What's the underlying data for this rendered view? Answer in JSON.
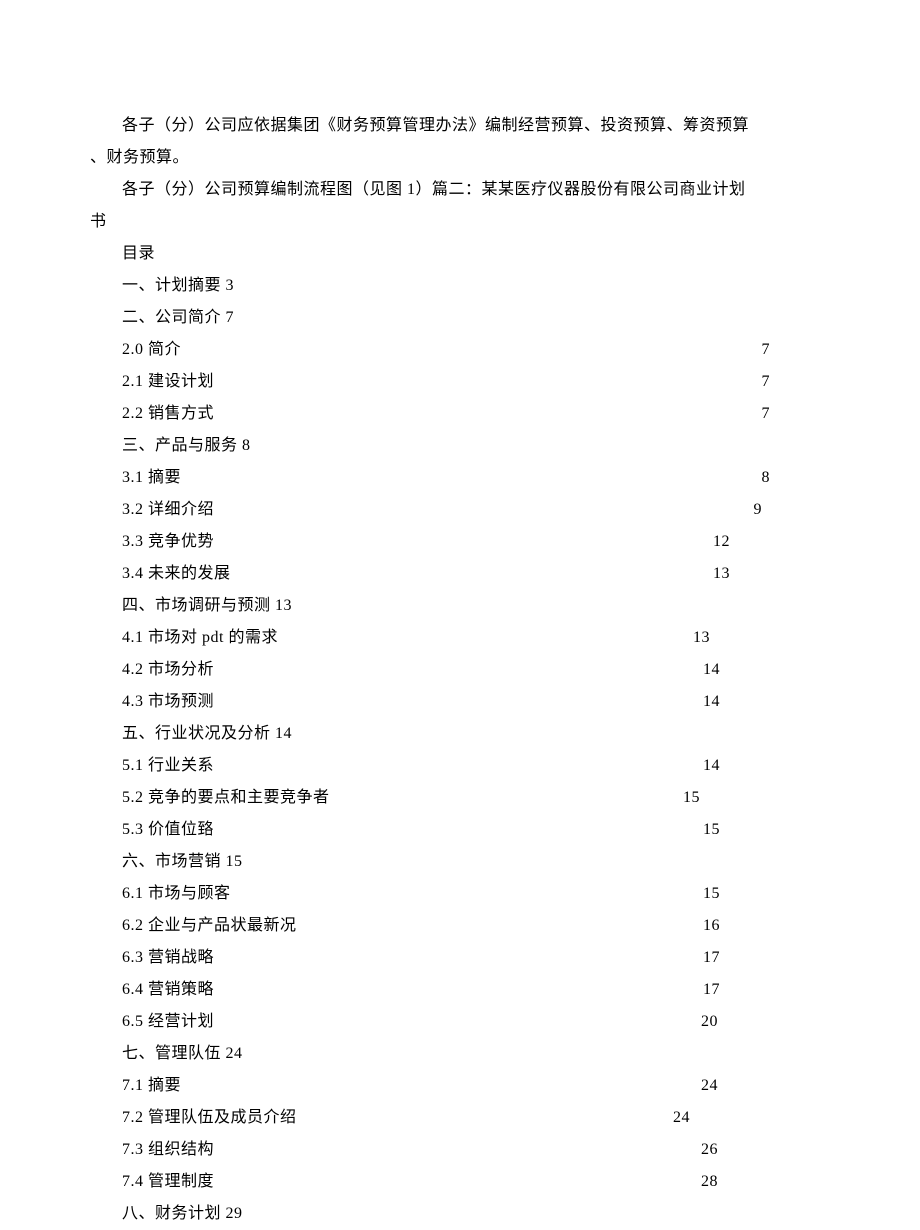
{
  "paragraphs": {
    "p1": "各子（分）公司应依据集团《财务预算管理办法》编制经营预算、投资预算、筹资预算",
    "p1cont": "、财务预算。",
    "p2": "各子（分）公司预算编制流程图（见图 1）篇二：某某医疗仪器股份有限公司商业计划",
    "p2cont": "书"
  },
  "toc": {
    "title": "目录",
    "sections": [
      {
        "label": "一、计划摘要  3",
        "page": ""
      },
      {
        "label": "二、公司简介  7",
        "page": ""
      }
    ],
    "rows": [
      {
        "label": "2.0 简介",
        "page": "7",
        "pos": "pos-7"
      },
      {
        "label": "2.1 建设计划",
        "page": "7",
        "pos": "pos-7"
      },
      {
        "label": "2.2 销售方式",
        "page": "7",
        "pos": "pos-7"
      }
    ],
    "section3": "三、产品与服务  8",
    "rows3": [
      {
        "label": "3.1 摘要",
        "page": "8",
        "pos": "pos-8"
      },
      {
        "label": "3.2 详细介绍",
        "page": "9",
        "pos": "pos-9"
      },
      {
        "label": "3.3 竞争优势",
        "page": "12",
        "pos": "pos-12"
      },
      {
        "label": "3.4 未来的发展",
        "page": "13",
        "pos": "pos-13"
      }
    ],
    "section4": "四、市场调研与预测  13",
    "rows4": [
      {
        "label": "4.1 市场对 pdt 的需求",
        "page": "13",
        "pos": "pos-13b"
      },
      {
        "label": "4.2 市场分析",
        "page": "14",
        "pos": "pos-14"
      },
      {
        "label": "4.3 市场预测",
        "page": "14",
        "pos": "pos-14"
      }
    ],
    "section5": "五、行业状况及分析  14",
    "rows5": [
      {
        "label": "5.1 行业关系",
        "page": "14",
        "pos": "pos-14"
      },
      {
        "label": "5.2 竞争的要点和主要竞争者",
        "page": "15",
        "pos": "pos-15"
      },
      {
        "label": "5.3 价值位臵",
        "page": "15",
        "pos": "pos-14"
      }
    ],
    "section6": "六、市场营销  15",
    "rows6": [
      {
        "label": "6.1 市场与顾客",
        "page": "15",
        "pos": "pos-14"
      },
      {
        "label": "6.2 企业与产品状最新况",
        "page": "16",
        "pos": "pos-16"
      },
      {
        "label": "6.3 营销战略",
        "page": "17",
        "pos": "pos-17"
      },
      {
        "label": "6.4 营销策略",
        "page": "17",
        "pos": "pos-17"
      },
      {
        "label": "6.5 经营计划",
        "page": "20",
        "pos": "pos-20"
      }
    ],
    "section7": "七、管理队伍  24",
    "rows7": [
      {
        "label": "7.1 摘要",
        "page": "24",
        "pos": "pos-24"
      },
      {
        "label": "7.2 管理队伍及成员介绍",
        "page": "24",
        "pos": "pos-24b"
      },
      {
        "label": "7.3 组织结构",
        "page": "26",
        "pos": "pos-26"
      },
      {
        "label": "7.4 管理制度",
        "page": "28",
        "pos": "pos-28"
      }
    ],
    "section8": "八、财务计划  29"
  }
}
